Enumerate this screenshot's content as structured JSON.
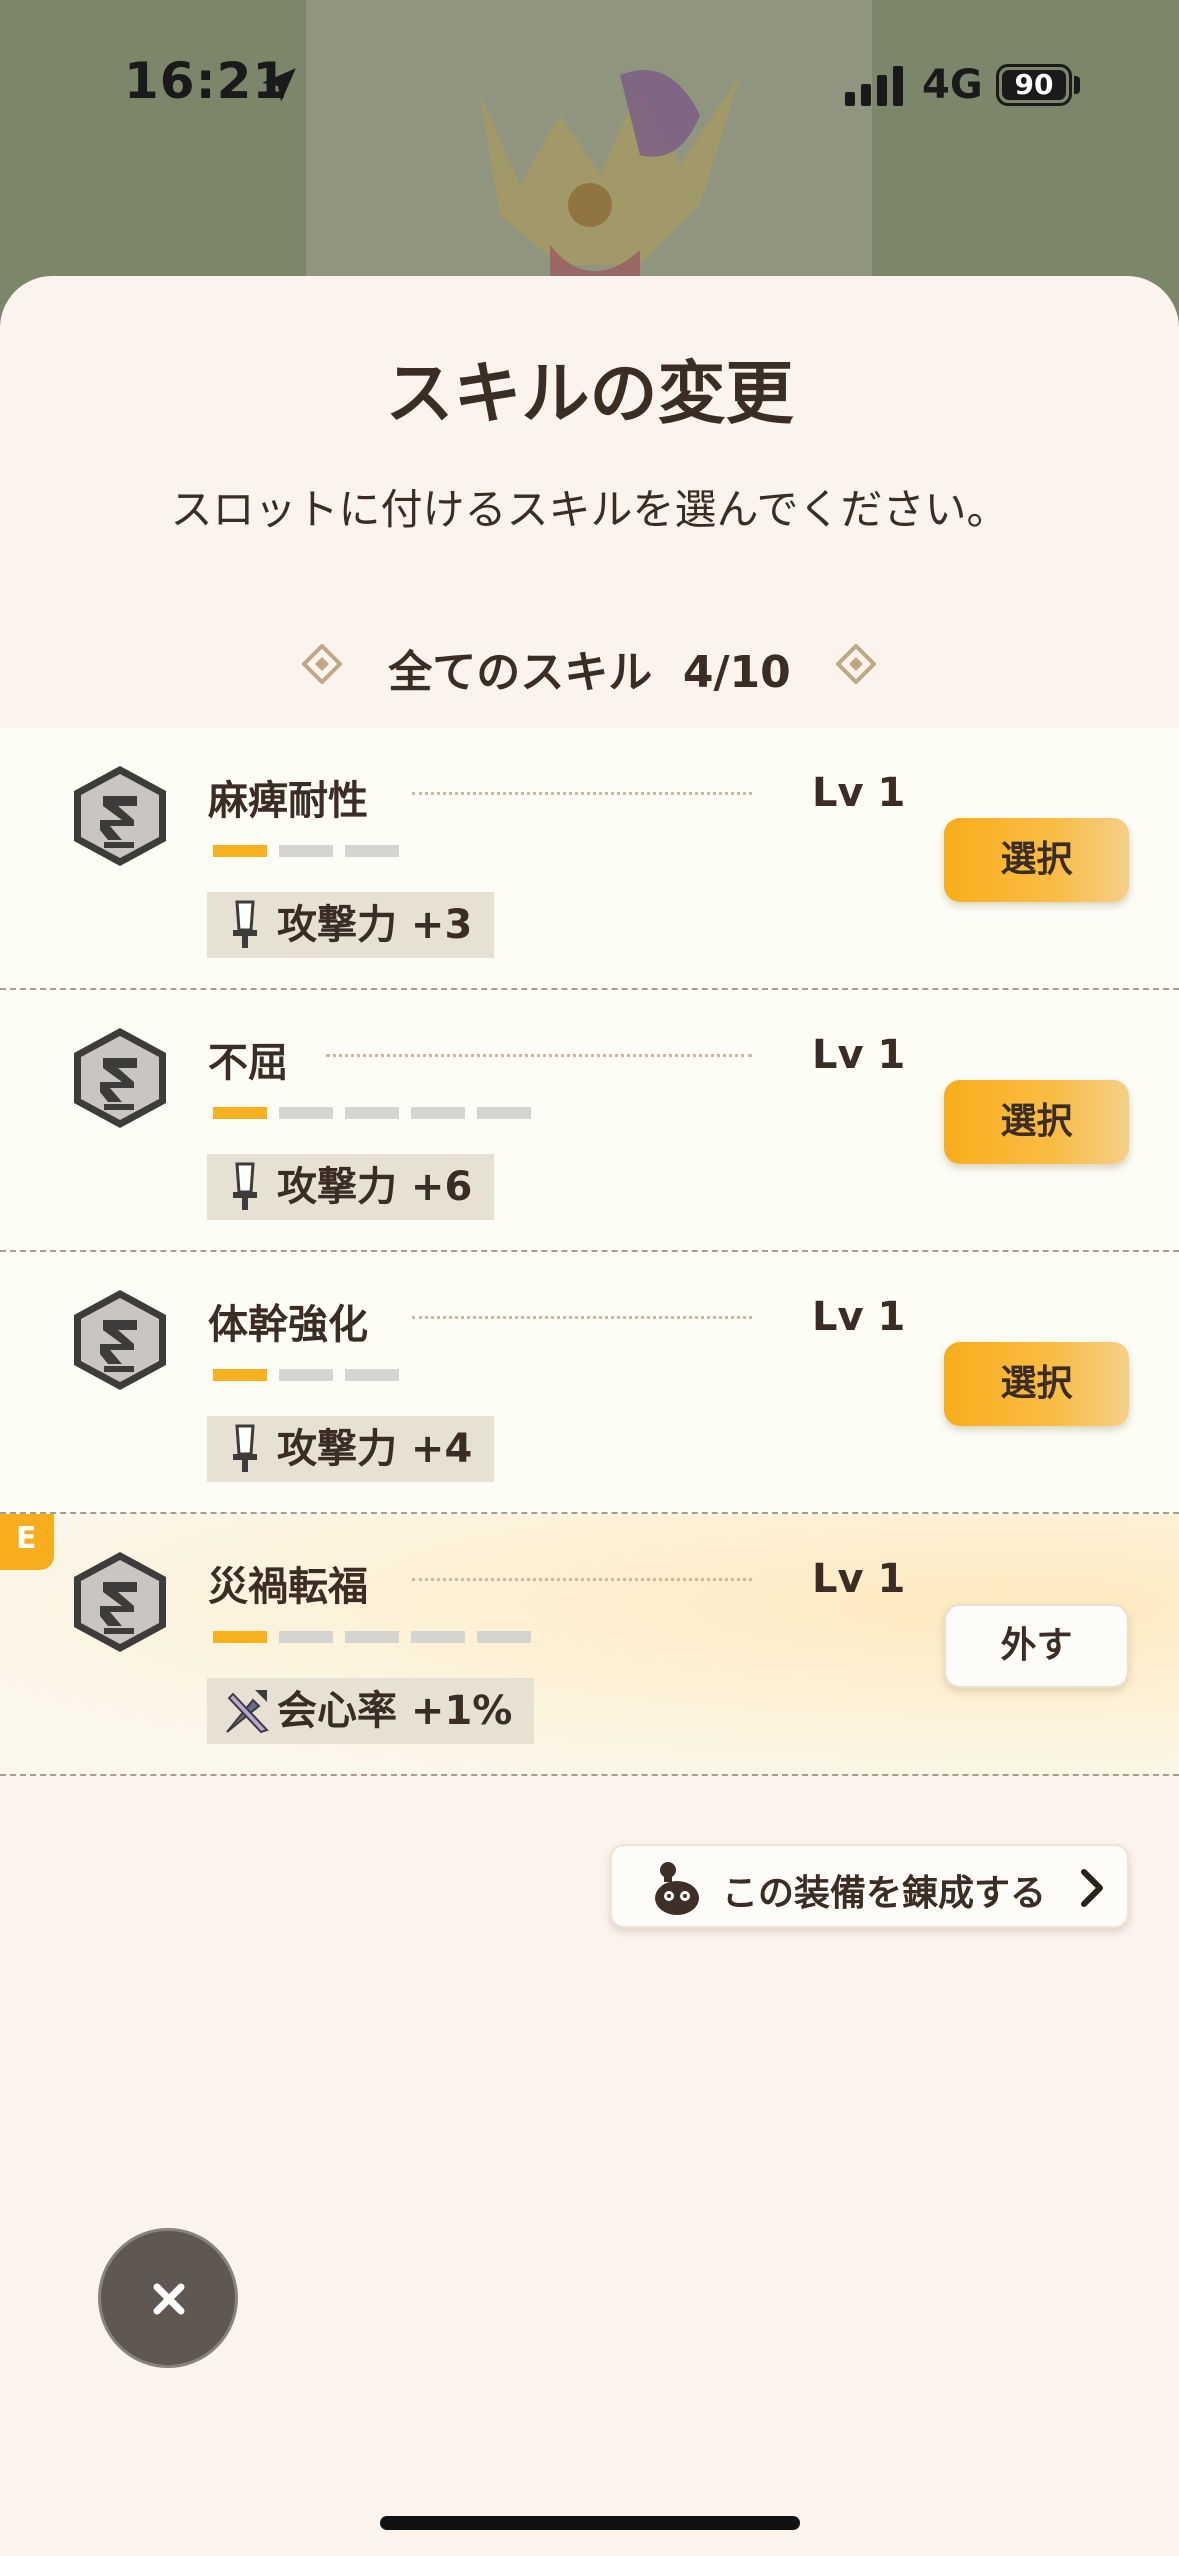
{
  "status_bar": {
    "time": "16:21",
    "network": "4G",
    "battery": "90"
  },
  "header": {
    "title": "スキルの変更",
    "subtitle": "スロットに付けるスキルを選んでください。",
    "filter_label": "全てのスキル",
    "filter_count": "4/10"
  },
  "skills": [
    {
      "name": "麻痺耐性",
      "level": "Lv 1",
      "max_level": 3,
      "current_level": 1,
      "bonus_icon": "attack-icon",
      "bonus": "攻撃力 +3",
      "action": "選択",
      "equipped": false
    },
    {
      "name": "不屈",
      "level": "Lv 1",
      "max_level": 5,
      "current_level": 1,
      "bonus_icon": "attack-icon",
      "bonus": "攻撃力 +6",
      "action": "選択",
      "equipped": false
    },
    {
      "name": "体幹強化",
      "level": "Lv 1",
      "max_level": 3,
      "current_level": 1,
      "bonus_icon": "attack-icon",
      "bonus": "攻撃力 +4",
      "action": "選択",
      "equipped": false
    },
    {
      "name": "災禍転福",
      "level": "Lv 1",
      "max_level": 5,
      "current_level": 1,
      "bonus_icon": "affinity-icon",
      "bonus": "会心率 +1%",
      "action": "外す",
      "equipped": true,
      "badge": "E"
    }
  ],
  "forge_button": {
    "label": "この装備を錬成する"
  },
  "colors": {
    "accent": "#f7b11e",
    "sheet_bg": "#fbf3ec",
    "text": "#3b2d24"
  }
}
